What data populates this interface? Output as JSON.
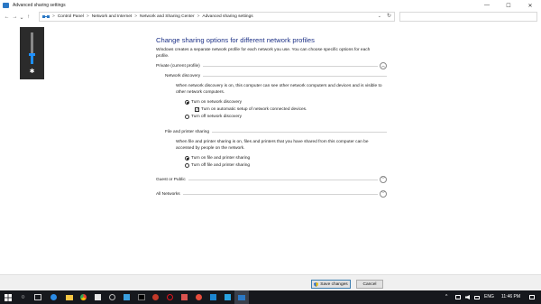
{
  "window": {
    "title": "Advanced sharing settings",
    "controls": {
      "minimize": "—",
      "maximize": "☐",
      "close": "✕"
    }
  },
  "nav": {
    "back": "←",
    "forward": "→",
    "recent": "⌄",
    "up": "↑"
  },
  "address": {
    "crumbs": [
      "Control Panel",
      "Network and Internet",
      "Network and Sharing Center",
      "Advanced sharing settings"
    ],
    "separator": ">",
    "dropdown": "⌄",
    "refresh": "↻"
  },
  "search": {
    "placeholder": ""
  },
  "volume": {
    "level": 0.3
  },
  "main": {
    "heading": "Change sharing options for different network profiles",
    "description": "Windows creates a separate network profile for each network you use. You can choose specific options for each profile."
  },
  "profiles": {
    "private": {
      "label": "Private (current profile)",
      "chevron": "︿",
      "network_discovery": {
        "label": "Network discovery",
        "description": "When network discovery is on, this computer can see other network computers and devices and is visible to other network computers.",
        "turn_on": "Turn on network discovery",
        "auto_setup": "Turn on automatic setup of network connected devices.",
        "turn_off": "Turn off network discovery"
      },
      "file_printer_sharing": {
        "label": "File and printer sharing",
        "description": "When file and printer sharing is on, files and printers that you have shared from this computer can be accessed by people on the network.",
        "turn_on": "Turn on file and printer sharing",
        "turn_off": "Turn off file and printer sharing"
      }
    },
    "guest": {
      "label": "Guest or Public",
      "chevron": "﹀"
    },
    "all": {
      "label": "All Networks",
      "chevron": "﹀"
    }
  },
  "buttons": {
    "save": "Save changes",
    "cancel": "Cancel"
  },
  "taskbar": {
    "search_icon": "○",
    "language": "ENG",
    "time": "11:46 PM",
    "tray_arrow": "^"
  }
}
